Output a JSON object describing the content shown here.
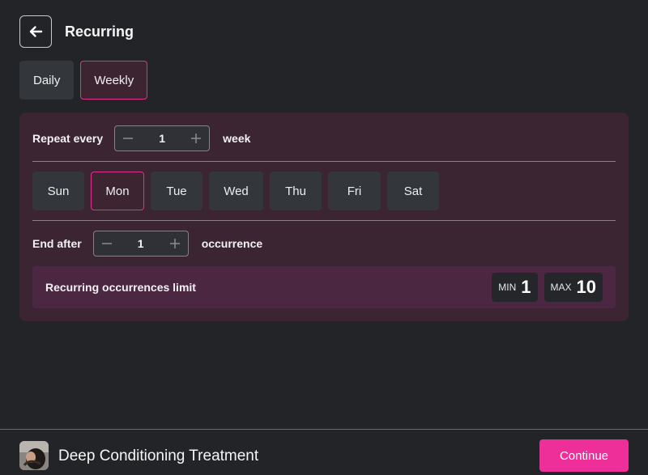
{
  "header": {
    "title": "Recurring",
    "back_icon": "arrow-left-icon"
  },
  "tabs": [
    {
      "label": "Daily",
      "active": false
    },
    {
      "label": "Weekly",
      "active": true
    }
  ],
  "repeat": {
    "label": "Repeat every",
    "value": "1",
    "unit": "week"
  },
  "days": [
    {
      "label": "Sun",
      "selected": false
    },
    {
      "label": "Mon",
      "selected": true
    },
    {
      "label": "Tue",
      "selected": false
    },
    {
      "label": "Wed",
      "selected": false
    },
    {
      "label": "Thu",
      "selected": false
    },
    {
      "label": "Fri",
      "selected": false
    },
    {
      "label": "Sat",
      "selected": false
    }
  ],
  "end": {
    "label": "End after",
    "value": "1",
    "unit": "occurrence"
  },
  "limits": {
    "label": "Recurring occurrences limit",
    "min_label": "MIN",
    "min_value": "1",
    "max_label": "MAX",
    "max_value": "10"
  },
  "footer": {
    "service_name": "Deep Conditioning Treatment",
    "continue_label": "Continue"
  },
  "colors": {
    "accent": "#ee2f9a",
    "background": "#222428",
    "panel": "#3b2532"
  }
}
